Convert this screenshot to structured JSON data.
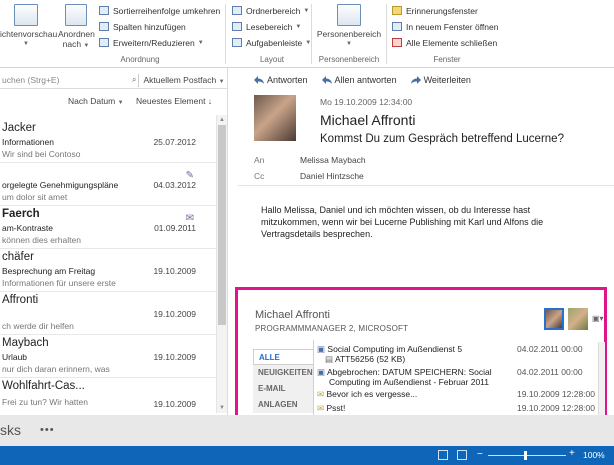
{
  "ribbon": {
    "view_btn": "ichtenvorschau",
    "arrange_btn_line1": "Anordnen",
    "arrange_btn_line2": "nach",
    "small_items": [
      "Sortierreihenfolge umkehren",
      "Spalten hinzufügen",
      "Erweitern/Reduzieren"
    ],
    "group_arrange": "Anordnung",
    "layout_items": [
      "Ordnerbereich",
      "Lesebereich",
      "Aufgabenleiste"
    ],
    "group_layout": "Layout",
    "people_btn": "Personenbereich",
    "group_people": "Personenbereich",
    "window_items": [
      "Erinnerungsfenster",
      "In neuem Fenster öffnen",
      "Alle Elemente schließen"
    ],
    "group_window": "Fenster"
  },
  "list": {
    "search_placeholder": "uchen (Strg+E)",
    "scope": "Aktuellem Postfach",
    "sort_by": "Nach Datum",
    "sort_order": "Neuestes Element",
    "messages": [
      {
        "sender": "Jacker",
        "subject": "Informationen",
        "preview": "Wir sind bei Contoso",
        "date": "25.07.2012"
      },
      {
        "sender": "",
        "subject": "orgelegte Genehmigungspläne",
        "preview": "um dolor sit amet",
        "date": "04.03.2012"
      },
      {
        "sender": "Faerch",
        "subject": "am-Kontraste",
        "preview": "können dies erhalten",
        "date": "01.09.2011"
      },
      {
        "sender": "chäfer",
        "subject": "Besprechung am Freitag",
        "preview": "Informationen für unsere erste",
        "date": "19.10.2009"
      },
      {
        "sender": "Affronti",
        "subject": "",
        "preview": "ch werde dir helfen",
        "date": "19.10.2009"
      },
      {
        "sender": "Maybach",
        "subject": "Urlaub",
        "preview": "nur dich daran erinnern, was",
        "date": "19.10.2009"
      },
      {
        "sender": "Wohlfahrt-Cas...",
        "subject": "",
        "preview": "Frei zu tun? Wir hatten",
        "date": "19.10.2009"
      }
    ]
  },
  "reading": {
    "reply": "Antworten",
    "reply_all": "Allen antworten",
    "forward": "Weiterleiten",
    "datetime": "Mo 19.10.2009 12:34:00",
    "sender": "Michael Affronti",
    "subject": "Kommst Du zum Gespräch betreffend Lucerne?",
    "to_label": "An",
    "to_value": "Melissa Maybach",
    "cc_label": "Cc",
    "cc_value": "Daniel Hintzsche",
    "body": "Hallo Melissa, Daniel und ich möchten wissen, ob du Interesse hast mitzukommen, wenn wir bei Lucerne Publishing mit Karl und Alfons die Vertragsdetails besprechen."
  },
  "people": {
    "name": "Michael Affronti",
    "title": "PROGRAMMMANAGER 2, MICROSOFT",
    "tabs": [
      "ALLE",
      "NEUIGKEITEN",
      "E-MAIL",
      "ANLAGEN"
    ],
    "items": [
      {
        "text": "Social Computing im Außendienst 5",
        "date": "04.02.2011 00:00"
      },
      {
        "text": "ATT56256 (52 KB)",
        "date": ""
      },
      {
        "text": "Abgebrochen: DATUM SPEICHERN: Social",
        "date": "04.02.2011 00:00"
      },
      {
        "text": "Computing im Außendienst - Februar 2011",
        "date": ""
      },
      {
        "text": "Bevor ich es vergesse...",
        "date": "19.10.2009 12:28:00"
      },
      {
        "text": "Psst!",
        "date": "19.10.2009 12:28:00"
      }
    ]
  },
  "nav": {
    "tasks": "sks",
    "more": "•••"
  },
  "status": {
    "zoom": "100%"
  }
}
